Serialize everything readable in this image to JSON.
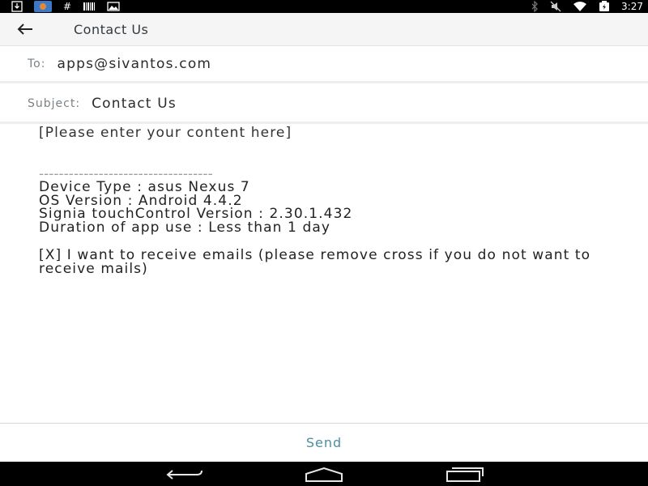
{
  "status_bar": {
    "left_icons": [
      "download-icon",
      "app-notification-icon",
      "hash-icon",
      "barcode-icon",
      "photo-icon"
    ],
    "right_icons": [
      "bluetooth-icon",
      "mute-icon",
      "wifi-icon",
      "battery-icon"
    ],
    "time": "3:27"
  },
  "app_bar": {
    "title": "Contact Us"
  },
  "to": {
    "label": "To:",
    "value": "apps@sivantos.com"
  },
  "subject": {
    "label": "Subject:",
    "value": "Contact Us"
  },
  "body": {
    "placeholder": "[Please enter your content here]",
    "divider": "-----------------------------------",
    "info_lines": [
      "Device Type : asus Nexus 7",
      "OS Version : Android 4.4.2",
      "Signia touchControl Version : 2.30.1.432",
      "Duration of app use : Less than 1 day"
    ],
    "opt_in": "[X] I want to receive emails (please remove cross if you do not want to receive mails)"
  },
  "send": {
    "label": "Send"
  },
  "colors": {
    "accent": "#4a8fa3",
    "app_bar_bg": "#f5f5f5",
    "status_bar_bg": "#000000"
  }
}
